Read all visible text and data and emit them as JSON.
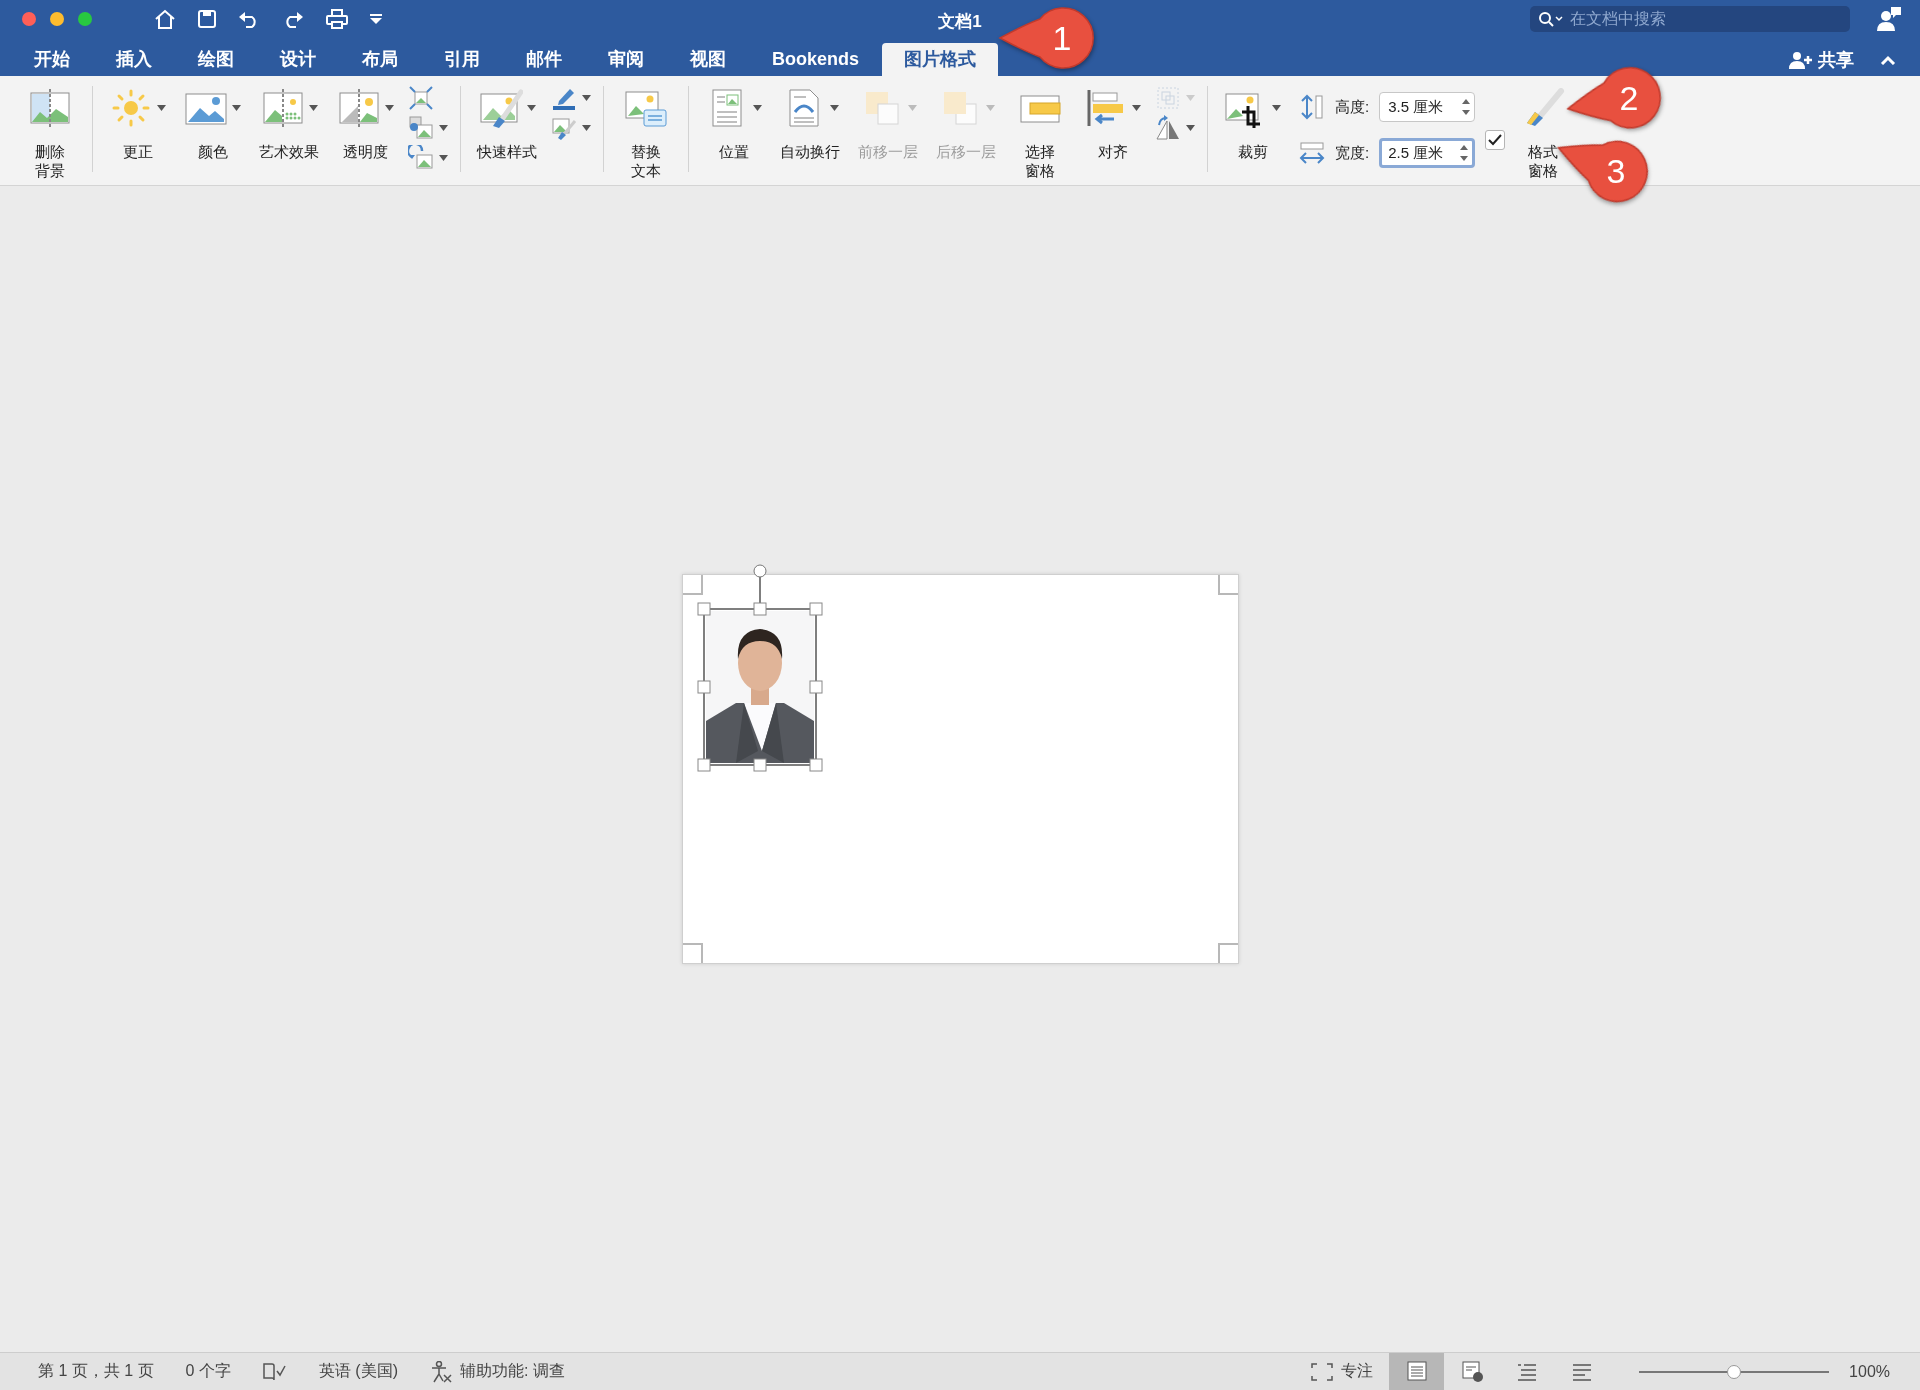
{
  "window": {
    "title": "文档1",
    "search": {
      "placeholder": "在文档中搜索"
    },
    "share": "共享"
  },
  "tabs": [
    {
      "label": "开始",
      "selected": false
    },
    {
      "label": "插入",
      "selected": false
    },
    {
      "label": "绘图",
      "selected": false
    },
    {
      "label": "设计",
      "selected": false
    },
    {
      "label": "布局",
      "selected": false
    },
    {
      "label": "引用",
      "selected": false
    },
    {
      "label": "邮件",
      "selected": false
    },
    {
      "label": "审阅",
      "selected": false
    },
    {
      "label": "视图",
      "selected": false
    },
    {
      "label": "Bookends",
      "selected": false
    },
    {
      "label": "图片格式",
      "selected": true
    }
  ],
  "ribbon": {
    "groups": [
      {
        "items": [
          {
            "kind": "button",
            "label": [
              "删除",
              "背景"
            ],
            "dropdown": false,
            "disabled": false
          }
        ]
      },
      {
        "items": [
          {
            "kind": "button",
            "label": "更正",
            "dropdown": true,
            "disabled": false
          },
          {
            "kind": "button",
            "label": "颜色",
            "dropdown": true,
            "disabled": false
          },
          {
            "kind": "button",
            "label": "艺术效果",
            "dropdown": true,
            "disabled": false
          },
          {
            "kind": "button",
            "label": "透明度",
            "dropdown": true,
            "disabled": false
          },
          {
            "kind": "stack",
            "tools": [
              {
                "dropdown": false,
                "disabled": false
              },
              {
                "dropdown": true,
                "disabled": false
              },
              {
                "dropdown": true,
                "disabled": false
              }
            ]
          }
        ]
      },
      {
        "items": [
          {
            "kind": "button",
            "label": "快速样式",
            "dropdown": true,
            "disabled": false
          },
          {
            "kind": "stack",
            "tools": [
              {
                "dropdown": true,
                "disabled": false
              },
              {
                "dropdown": true,
                "disabled": false
              }
            ]
          }
        ]
      },
      {
        "items": [
          {
            "kind": "button",
            "label": [
              "替换",
              "文本"
            ],
            "dropdown": false,
            "disabled": false
          }
        ]
      },
      {
        "items": [
          {
            "kind": "button",
            "label": "位置",
            "dropdown": true,
            "disabled": false
          },
          {
            "kind": "button",
            "label": "自动换行",
            "dropdown": true,
            "disabled": false
          },
          {
            "kind": "button",
            "label": "前移一层",
            "dropdown": true,
            "disabled": true
          },
          {
            "kind": "button",
            "label": "后移一层",
            "dropdown": true,
            "disabled": true
          },
          {
            "kind": "button",
            "label": [
              "选择",
              "窗格"
            ],
            "dropdown": false,
            "disabled": false
          },
          {
            "kind": "button",
            "label": "对齐",
            "dropdown": true,
            "disabled": false
          },
          {
            "kind": "stack",
            "tools": [
              {
                "dropdown": true,
                "disabled": true
              },
              {
                "dropdown": true,
                "disabled": false
              }
            ]
          }
        ]
      },
      {
        "items": [
          {
            "kind": "button",
            "label": "裁剪",
            "dropdown": true,
            "disabled": false
          },
          {
            "kind": "size",
            "fields": [
              {
                "label": "高度:",
                "value": "3.5 厘米",
                "focused": false
              },
              {
                "label": "宽度:",
                "value": "2.5 厘米",
                "focused": true
              }
            ]
          },
          {
            "kind": "checkbox",
            "checked": true
          },
          {
            "kind": "button",
            "label": [
              "格式",
              "窗格"
            ],
            "dropdown": false,
            "disabled": false
          }
        ]
      }
    ]
  },
  "document": {
    "image": {
      "selected": true
    }
  },
  "status_bar": {
    "left": [
      {
        "kind": "text",
        "text": "第 1 页，共 1 页"
      },
      {
        "kind": "text",
        "text": "0 个字"
      },
      {
        "kind": "proofing"
      },
      {
        "kind": "text",
        "text": "英语 (美国)"
      },
      {
        "kind": "accessibility",
        "text": "辅助功能: 调查"
      }
    ],
    "focus": "专注",
    "views": [
      {
        "selected": true
      },
      {
        "selected": false
      },
      {
        "selected": false
      },
      {
        "selected": false
      }
    ],
    "zoom": {
      "level": 0.5,
      "reading": "100%"
    }
  },
  "callouts": [
    {
      "number": "1"
    },
    {
      "number": "2"
    },
    {
      "number": "3"
    }
  ]
}
